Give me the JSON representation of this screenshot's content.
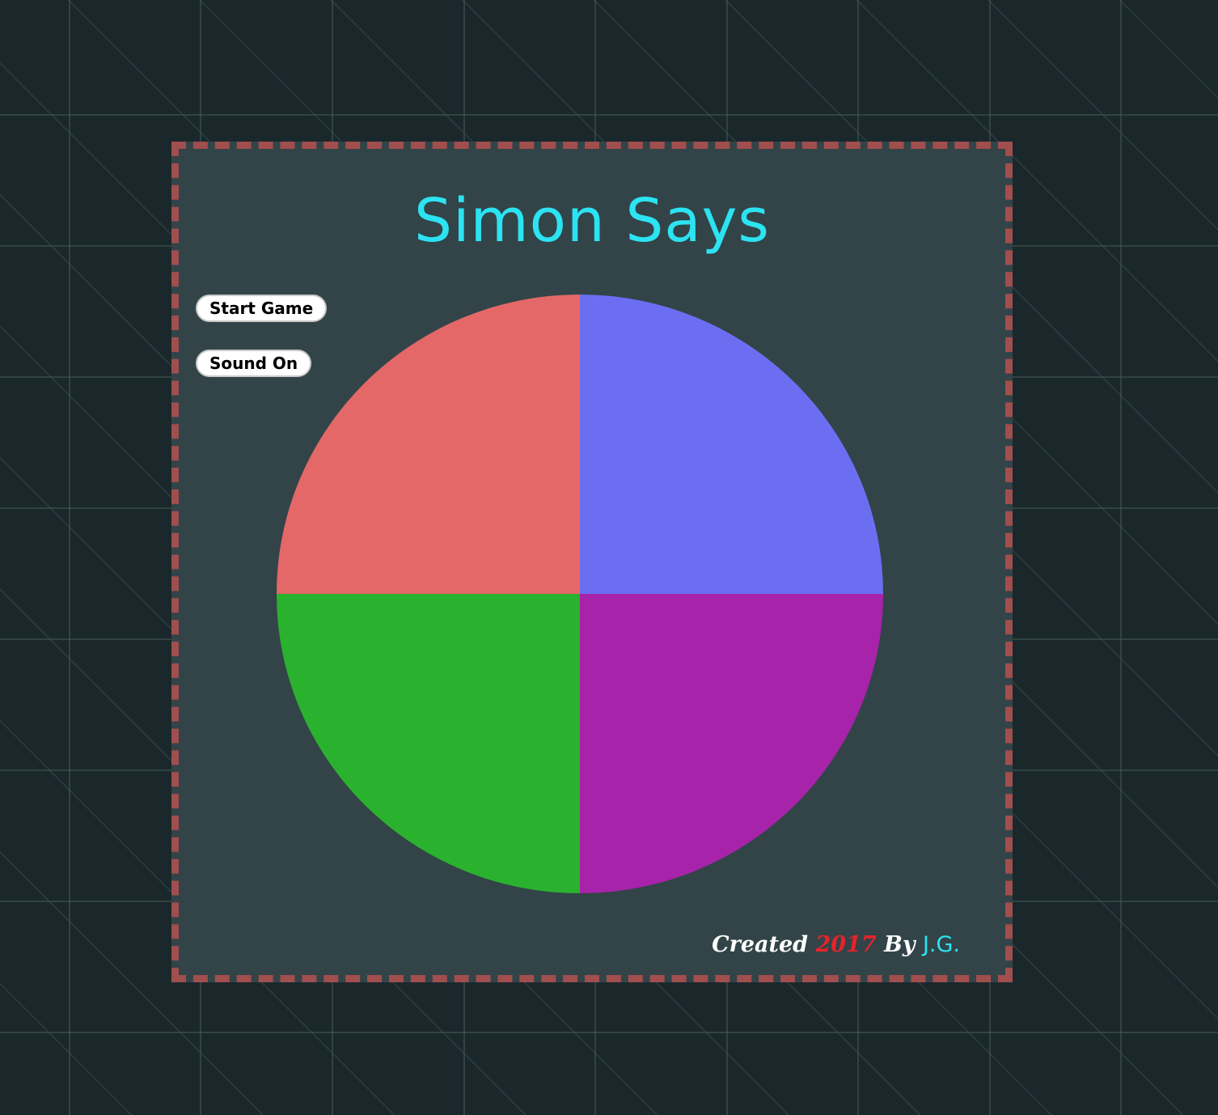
{
  "page": {
    "background_color": "#1a282c",
    "grid_color": "#4c5f5e"
  },
  "game": {
    "title": "Simon Says",
    "title_color": "#2ce3f2",
    "panel_color": "#324448",
    "border_color": "#a04e4e",
    "buttons": {
      "start_label": "Start Game",
      "sound_label": "Sound On"
    },
    "quadrants": [
      {
        "id": "top-left",
        "color": "#e46868"
      },
      {
        "id": "top-right",
        "color": "#6c6ef2"
      },
      {
        "id": "bottom-left",
        "color": "#2ab22e"
      },
      {
        "id": "bottom-right",
        "color": "#a723aa"
      }
    ],
    "footer": {
      "created": "Created",
      "year": "2017",
      "by": "By",
      "author": "J.G."
    }
  }
}
